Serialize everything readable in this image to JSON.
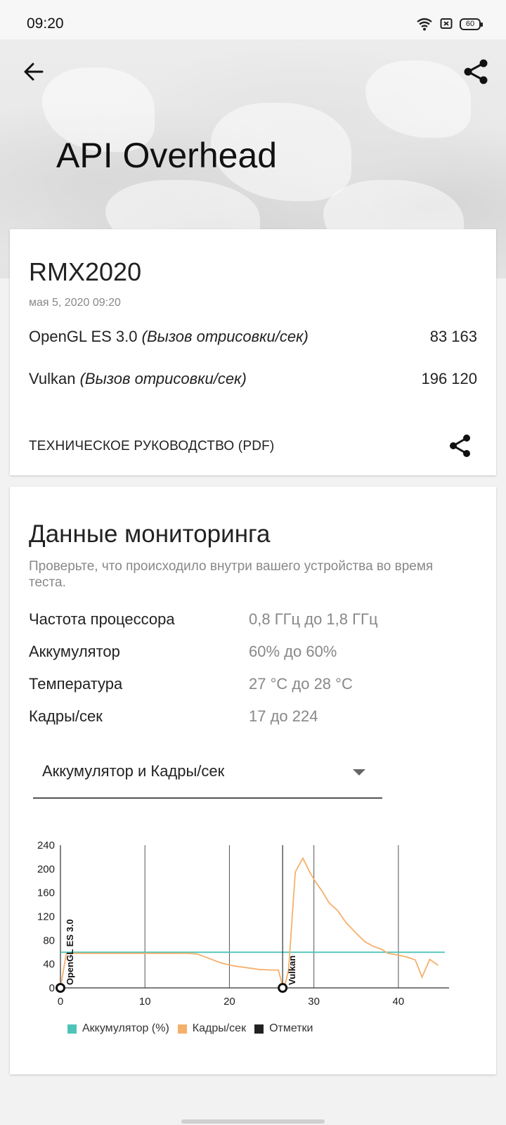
{
  "status_bar": {
    "time": "09:20",
    "battery": "60"
  },
  "header": {
    "title": "API Overhead"
  },
  "result_card": {
    "device": "RMX2020",
    "date": "мая 5, 2020 09:20",
    "scores": [
      {
        "api": "OpenGL ES 3.0",
        "unit": "(Вызов отрисовки/сек)",
        "value": "83 163"
      },
      {
        "api": "Vulkan",
        "unit": "(Вызов отрисовки/сек)",
        "value": "196 120"
      }
    ],
    "guide_label": "ТЕХНИЧЕСКОЕ РУКОВОДСТВО (PDF)"
  },
  "monitoring": {
    "title": "Данные мониторинга",
    "subtitle": "Проверьте, что происходило внутри вашего устройства во время теста.",
    "rows": [
      {
        "key": "Частота процессора",
        "value": "0,8 ГГц до 1,8 ГГц"
      },
      {
        "key": "Аккумулятор",
        "value": "60% до 60%"
      },
      {
        "key": "Температура",
        "value": "27 °C до 28 °C"
      },
      {
        "key": "Кадры/сек",
        "value": "17 до 224"
      }
    ],
    "select_value": "Аккумулятор и Кадры/сек",
    "legend": [
      {
        "label": "Аккумулятор (%)",
        "color": "#4fc3b8"
      },
      {
        "label": "Кадры/сек",
        "color": "#f5b06c"
      },
      {
        "label": "Отметки",
        "color": "#222222"
      }
    ]
  },
  "chart_data": {
    "type": "line",
    "xlim": [
      0,
      46
    ],
    "ylim": [
      0,
      240
    ],
    "x_ticks": [
      0,
      10,
      20,
      30,
      40
    ],
    "y_ticks": [
      0,
      40,
      80,
      120,
      160,
      200,
      240
    ],
    "series": [
      {
        "name": "Аккумулятор (%)",
        "color": "#4fc3b8",
        "points": [
          [
            0,
            60
          ],
          [
            45.5,
            60
          ]
        ]
      },
      {
        "name": "Кадры/сек",
        "color": "#f5b06c",
        "points": [
          [
            0,
            0
          ],
          [
            0.7,
            58
          ],
          [
            2,
            58
          ],
          [
            5,
            58
          ],
          [
            10,
            58
          ],
          [
            15,
            58
          ],
          [
            16.2,
            57
          ],
          [
            17.5,
            50
          ],
          [
            19,
            42
          ],
          [
            20.5,
            37
          ],
          [
            22,
            34
          ],
          [
            23.5,
            31
          ],
          [
            25,
            30
          ],
          [
            25.8,
            30
          ],
          [
            26.2,
            8
          ],
          [
            26.5,
            0
          ],
          [
            27,
            30
          ],
          [
            27.8,
            195
          ],
          [
            28.7,
            218
          ],
          [
            29.5,
            195
          ],
          [
            30.2,
            178
          ],
          [
            31,
            162
          ],
          [
            31.8,
            143
          ],
          [
            32.8,
            130
          ],
          [
            33.8,
            110
          ],
          [
            35,
            92
          ],
          [
            36,
            78
          ],
          [
            37,
            70
          ],
          [
            38,
            65
          ],
          [
            38.8,
            58
          ],
          [
            40,
            55
          ],
          [
            41,
            52
          ],
          [
            42,
            47
          ],
          [
            42.8,
            18
          ],
          [
            43.7,
            48
          ],
          [
            44.7,
            38
          ]
        ]
      }
    ],
    "markers": [
      {
        "x": 0,
        "label": "OpenGL ES 3.0"
      },
      {
        "x": 26.3,
        "label": "Vulkan"
      }
    ]
  }
}
